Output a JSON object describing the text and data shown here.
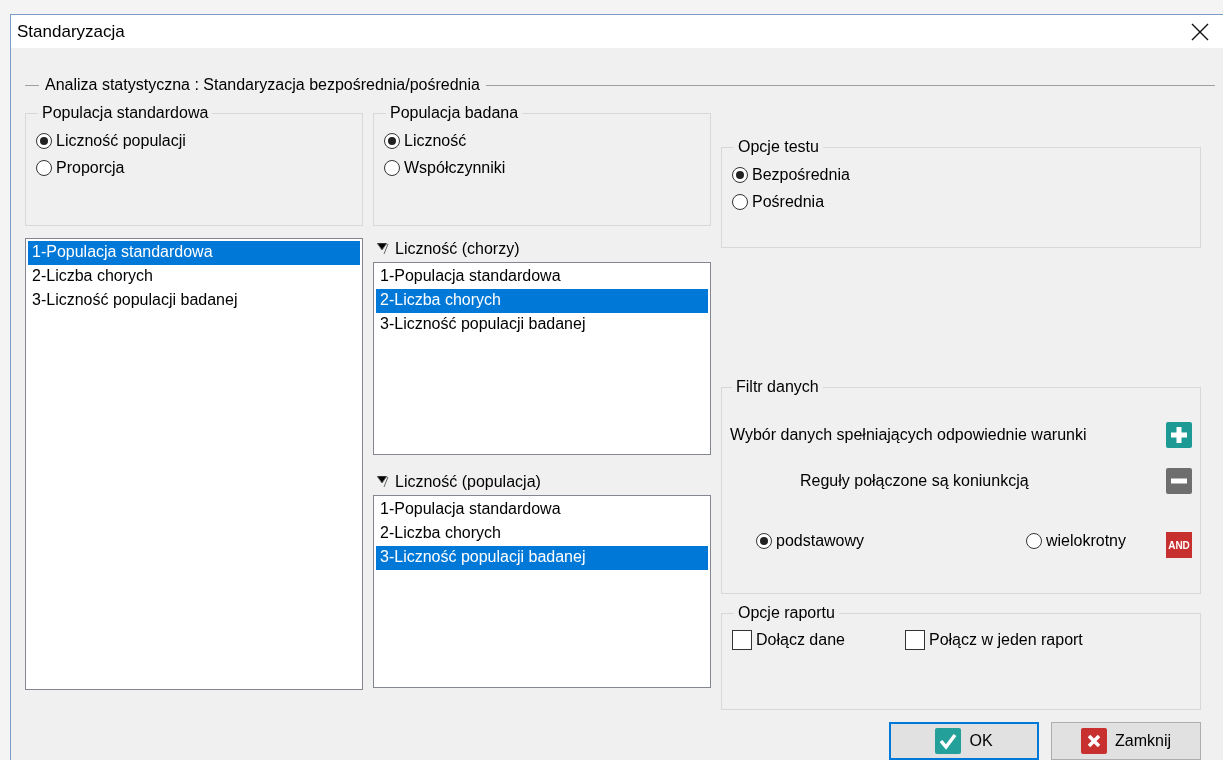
{
  "window": {
    "title": "Standaryzacja"
  },
  "section_title": "Analiza statystyczna : Standaryzacja bezpośrednia/pośrednia",
  "standard_population": {
    "title": "Populacja standardowa",
    "options": [
      {
        "label": "Liczność populacji",
        "selected": true
      },
      {
        "label": "Proporcja",
        "selected": false
      }
    ],
    "list": [
      {
        "label": "1-Populacja standardowa",
        "selected": true
      },
      {
        "label": "2-Liczba chorych",
        "selected": false
      },
      {
        "label": "3-Liczność populacji badanej",
        "selected": false
      }
    ]
  },
  "studied_population": {
    "title": "Populacja badana",
    "options": [
      {
        "label": "Liczność",
        "selected": true
      },
      {
        "label": "Współczynniki",
        "selected": false
      }
    ],
    "lists": [
      {
        "label": "Liczność (chorzy)",
        "items": [
          {
            "label": "1-Populacja standardowa",
            "selected": false
          },
          {
            "label": "2-Liczba chorych",
            "selected": true
          },
          {
            "label": "3-Liczność populacji badanej",
            "selected": false
          }
        ]
      },
      {
        "label": "Liczność (populacja)",
        "items": [
          {
            "label": "1-Populacja standardowa",
            "selected": false
          },
          {
            "label": "2-Liczba chorych",
            "selected": false
          },
          {
            "label": "3-Liczność populacji badanej",
            "selected": true
          }
        ]
      }
    ]
  },
  "test_options": {
    "title": "Opcje testu",
    "options": [
      {
        "label": "Bezpośrednia",
        "selected": true
      },
      {
        "label": "Pośrednia",
        "selected": false
      }
    ]
  },
  "data_filter": {
    "title": "Filtr danych",
    "add_label": "Wybór danych spełniających odpowiednie warunki",
    "rules_label": "Reguły połączone są koniunkcją",
    "and_label": "AND",
    "options": [
      {
        "label": "podstawowy",
        "selected": true
      },
      {
        "label": "wielokrotny",
        "selected": false
      }
    ]
  },
  "report_options": {
    "title": "Opcje raportu",
    "checkboxes": [
      {
        "label": "Dołącz dane",
        "checked": false
      },
      {
        "label": "Połącz w jeden raport",
        "checked": false
      }
    ]
  },
  "buttons": [
    {
      "kind": "ok",
      "label": "OK",
      "focused": true
    },
    {
      "kind": "close",
      "label": "Zamknij",
      "focused": false
    }
  ]
}
